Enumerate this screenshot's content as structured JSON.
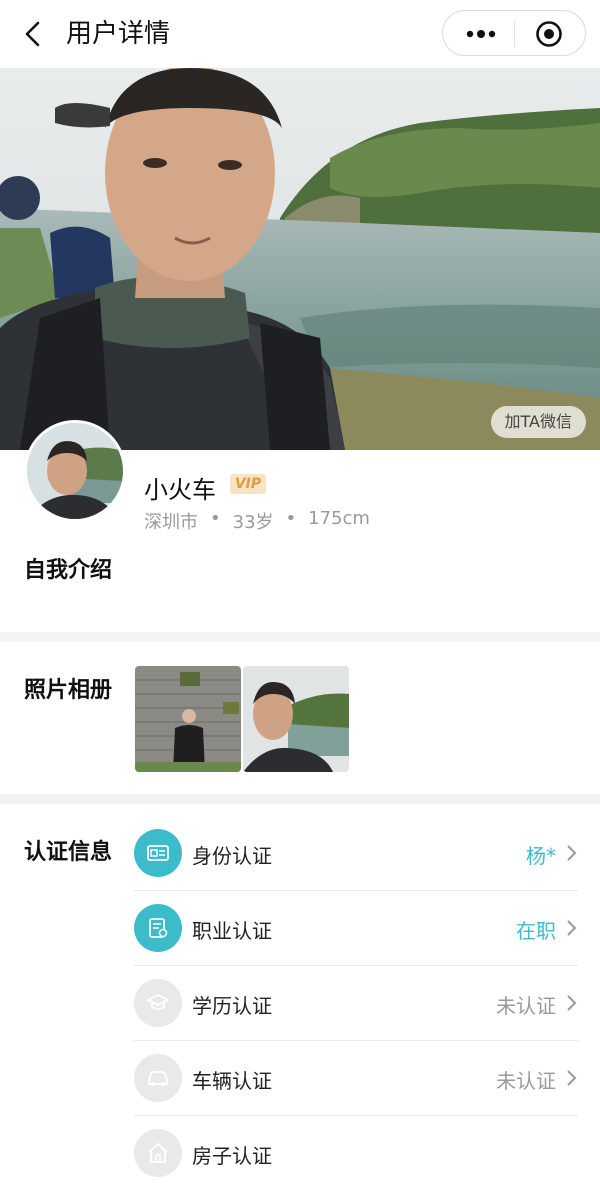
{
  "header": {
    "title": "用户详情",
    "back_icon": "back-arrow-icon",
    "more_icon": "more-dots-icon",
    "close_icon": "target-circle-icon"
  },
  "hero": {
    "wechat_button": "加TA微信"
  },
  "profile": {
    "name": "小火车",
    "vip_badge": "VIP",
    "city": "深圳市",
    "age": "33岁",
    "height": "175cm",
    "separator": "•"
  },
  "sections": {
    "intro_title": "自我介绍",
    "album_title": "照片相册",
    "verify_title": "认证信息"
  },
  "verification": [
    {
      "label": "身份认证",
      "status": "杨*",
      "icon": "id-card-icon",
      "active": true
    },
    {
      "label": "职业认证",
      "status": "在职",
      "icon": "work-badge-icon",
      "active": true
    },
    {
      "label": "学历认证",
      "status": "未认证",
      "icon": "graduation-cap-icon",
      "active": false
    },
    {
      "label": "车辆认证",
      "status": "未认证",
      "icon": "car-icon",
      "active": false
    },
    {
      "label": "房子认证",
      "status": "",
      "icon": "house-icon",
      "active": false
    }
  ],
  "colors": {
    "accent": "#3cbccb",
    "inactive": "#e9e9e9",
    "vip_bg": "#f7e3c6",
    "vip_text": "#e39b3e"
  }
}
